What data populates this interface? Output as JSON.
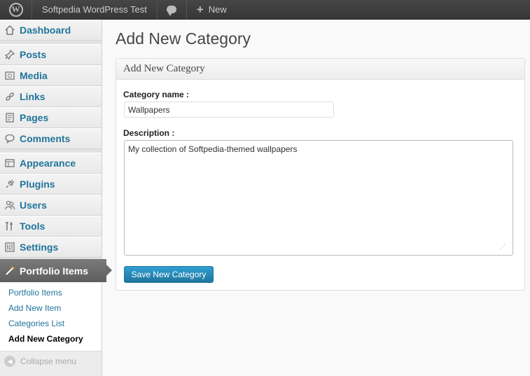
{
  "admin_bar": {
    "site_name": "Softpedia WordPress Test",
    "new_label": "New"
  },
  "sidebar": {
    "items": [
      {
        "label": "Dashboard",
        "icon": "dashboard-icon"
      },
      {
        "label": "Posts",
        "icon": "pushpin-icon"
      },
      {
        "label": "Media",
        "icon": "media-icon"
      },
      {
        "label": "Links",
        "icon": "link-icon"
      },
      {
        "label": "Pages",
        "icon": "pages-icon"
      },
      {
        "label": "Comments",
        "icon": "comment-icon"
      },
      {
        "label": "Appearance",
        "icon": "appearance-icon"
      },
      {
        "label": "Plugins",
        "icon": "plug-icon"
      },
      {
        "label": "Users",
        "icon": "users-icon"
      },
      {
        "label": "Tools",
        "icon": "tools-icon"
      },
      {
        "label": "Settings",
        "icon": "settings-icon"
      }
    ],
    "active": {
      "label": "Portfolio Items",
      "icon": "wand-icon"
    },
    "submenu": [
      "Portfolio Items",
      "Add New Item",
      "Categories List",
      "Add New Category"
    ],
    "collapse_label": "Collapse menu"
  },
  "main": {
    "page_title": "Add New Category",
    "box_title": "Add New Category",
    "name_label": "Category name :",
    "name_value": "Wallpapers",
    "description_label": "Description :",
    "description_value": "My collection of Softpedia-themed wallpapers",
    "save_label": "Save New Category"
  },
  "colors": {
    "link": "#21759b",
    "admin_bar": "#464646",
    "button": "#21759b"
  }
}
